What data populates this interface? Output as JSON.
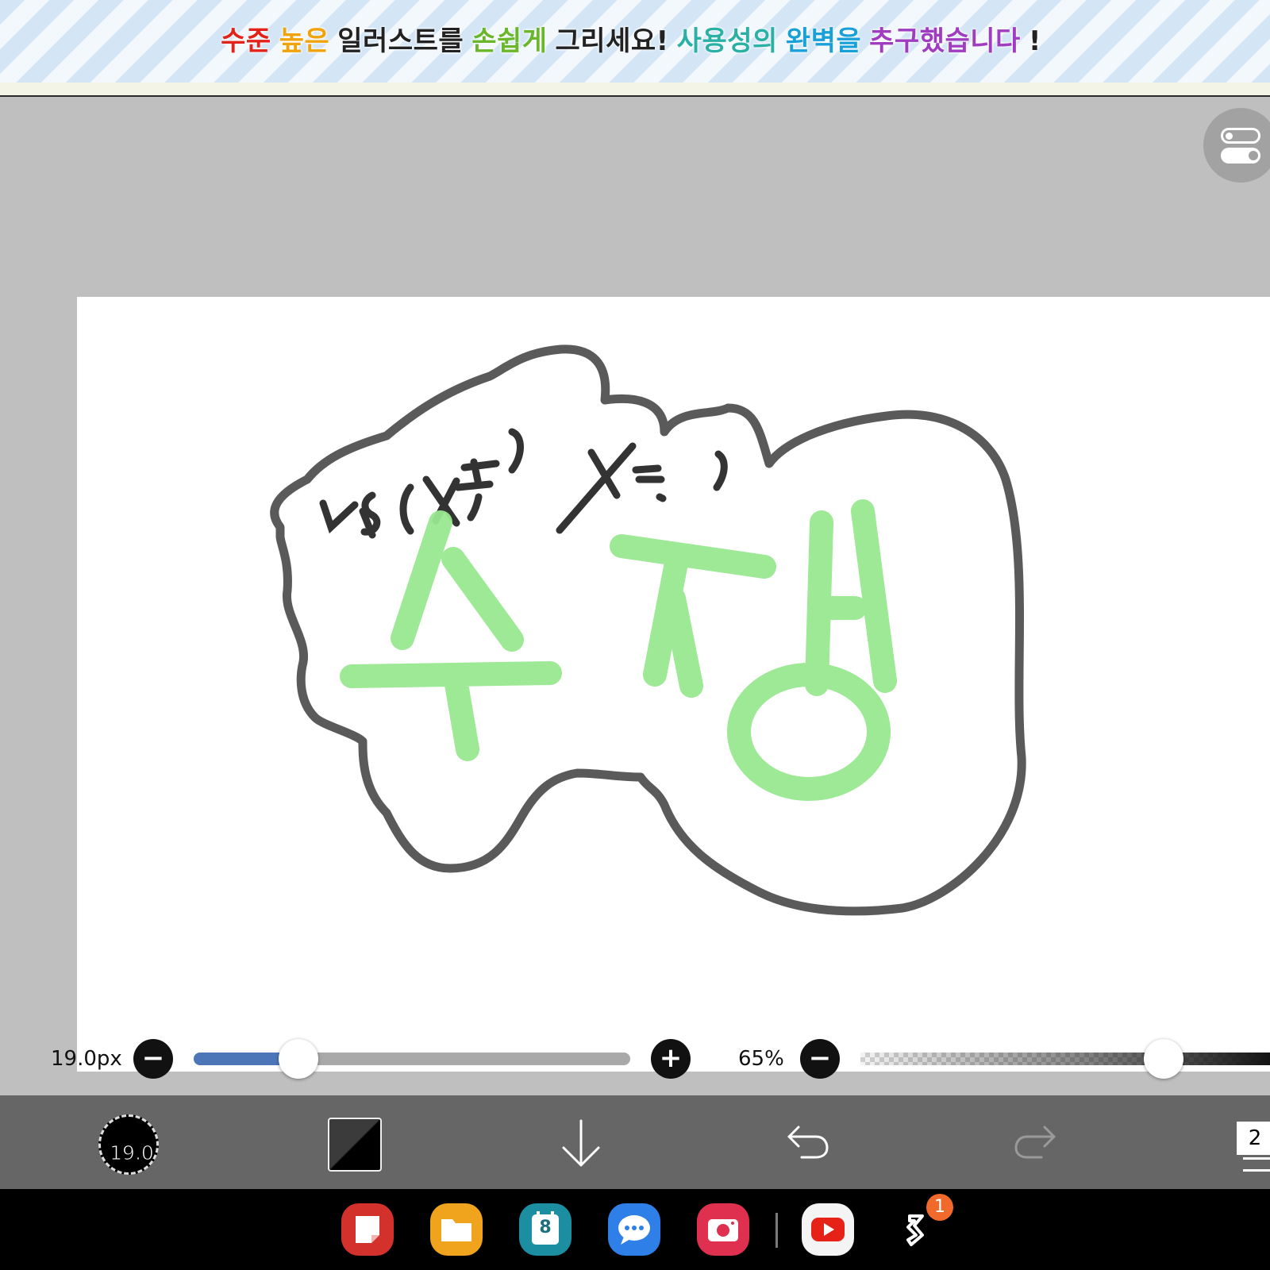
{
  "banner": {
    "segments": [
      {
        "text": "수준",
        "color": "#e2231a"
      },
      {
        "text": "높은",
        "color": "#f0a30a"
      },
      {
        "text": "일러스트를",
        "color": "#222222"
      },
      {
        "text": "손쉽게",
        "color": "#6ab72c"
      },
      {
        "text": "그리세요!",
        "color": "#222222"
      },
      {
        "text": "사용성의",
        "color": "#2ab0a5"
      },
      {
        "text": "완벽을",
        "color": "#1aa0d8"
      },
      {
        "text": "추구했습니다",
        "color": "#a03cc0"
      },
      {
        "text": "!",
        "color": "#222222"
      }
    ]
  },
  "canvas": {
    "drawing_text": "수정",
    "scribble_left": "ㄴ5(X,ㅊ)",
    "scribble_right": "Y:-:)",
    "outline_color": "#5a5a5a",
    "text_color": "#98e890",
    "scribble_color": "#333333"
  },
  "brush_size": {
    "label": "19.0px",
    "value_fraction": 0.24,
    "minus_label": "−",
    "plus_label": "+"
  },
  "opacity": {
    "label": "65%",
    "value_fraction": 0.74,
    "minus_label": "−"
  },
  "toolbar": {
    "brush_value": "19.0",
    "layer_count": "2",
    "icons": [
      "brush-size-icon",
      "color-swatch-icon",
      "download-icon",
      "undo-icon",
      "redo-icon",
      "layers-icon"
    ]
  },
  "dock": {
    "apps": [
      "notes-app-icon",
      "my-files-app-icon",
      "calendar-app-icon",
      "messages-app-icon",
      "camera-app-icon",
      "youtube-app-icon",
      "ibis-paint-app-icon"
    ],
    "calendar_day": "8",
    "badge_count": "1"
  },
  "colors": {
    "workspace_bg": "#bfbfbf",
    "toolbar_bg": "#666666",
    "slider_fill": "#4d76b9"
  }
}
